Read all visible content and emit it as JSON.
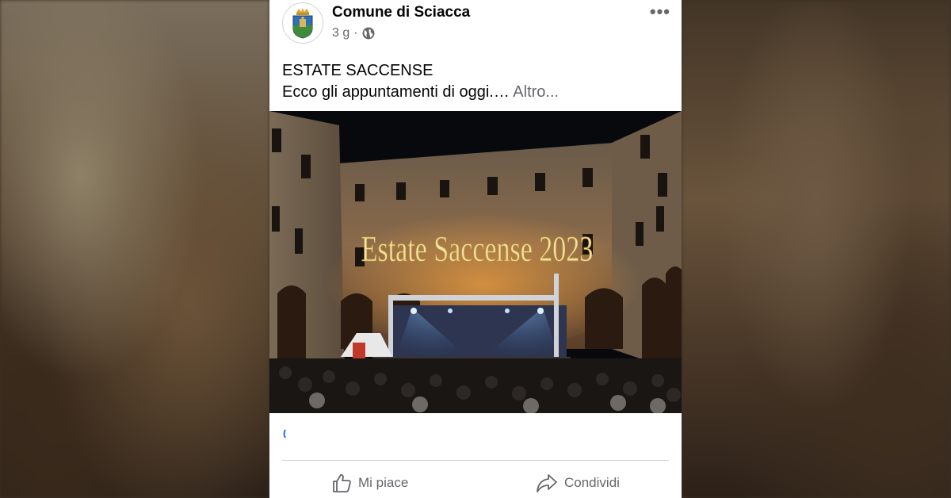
{
  "post": {
    "page_name": "Comune di Sciacca",
    "time_ago": "3 g",
    "separator": "·",
    "audience_icon": "globe-icon",
    "menu_icon": "more-horizontal-icon",
    "menu_label": "•••",
    "title": "ESTATE SACCENSE",
    "body": "Ecco gli appuntamenti di oggi.…",
    "see_more": "Altro...",
    "photo_overlay_text": "Estate Saccense 2023"
  },
  "actions": {
    "like_label": "Mi piace",
    "like_icon": "thumbs-up-icon",
    "share_label": "Condividi",
    "share_icon": "share-arrow-icon"
  },
  "colors": {
    "text_primary": "#050505",
    "text_secondary": "#65676b",
    "divider": "#ced0d4",
    "accent": "#1877f2"
  }
}
